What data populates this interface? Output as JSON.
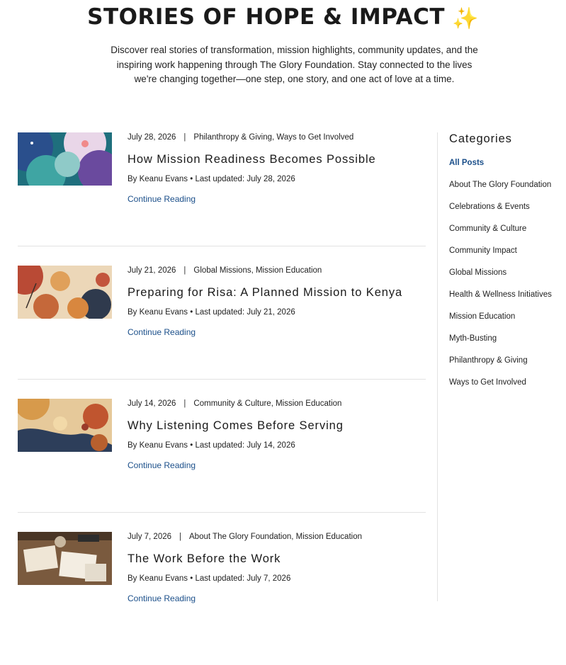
{
  "header": {
    "title": "STORIES OF HOPE & IMPACT",
    "title_icon": "sparkles-icon",
    "subtitle": "Discover real stories of transformation, mission highlights, community updates, and the inspiring work happening through The Glory Foundation. Stay connected to the lives we're changing together—one step, one story, and one act of love at a time."
  },
  "posts": [
    {
      "date": "July 28, 2026",
      "categories": "Philanthropy & Giving, Ways to Get Involved",
      "title": "How Mission Readiness Becomes Possible",
      "byline": "By Keanu Evans • Last updated: July 28, 2026",
      "link": "Continue Reading"
    },
    {
      "date": "July 21, 2026",
      "categories": "Global Missions, Mission Education",
      "title": "Preparing for Risa: A Planned Mission to Kenya",
      "byline": "By Keanu Evans • Last updated: July 21, 2026",
      "link": "Continue Reading"
    },
    {
      "date": "July 14, 2026",
      "categories": "Community & Culture, Mission Education",
      "title": "Why Listening Comes Before Serving",
      "byline": "By Keanu Evans • Last updated: July 14, 2026",
      "link": "Continue Reading"
    },
    {
      "date": "July 7, 2026",
      "categories": "About The Glory Foundation, Mission Education",
      "title": "The Work Before the Work",
      "byline": "By Keanu Evans • Last updated: July 7, 2026",
      "link": "Continue Reading"
    }
  ],
  "sidebar": {
    "heading": "Categories",
    "items": [
      "All Posts",
      "About The Glory Foundation",
      "Celebrations & Events",
      "Community & Culture",
      "Community Impact",
      "Global Missions",
      "Health & Wellness Initiatives",
      "Mission Education",
      "Myth-Busting",
      "Philanthropy & Giving",
      "Ways to Get Involved"
    ],
    "active_index": 0
  },
  "colors": {
    "link": "#1b4f8a",
    "divider": "#e2e2e2",
    "text": "#222222"
  }
}
